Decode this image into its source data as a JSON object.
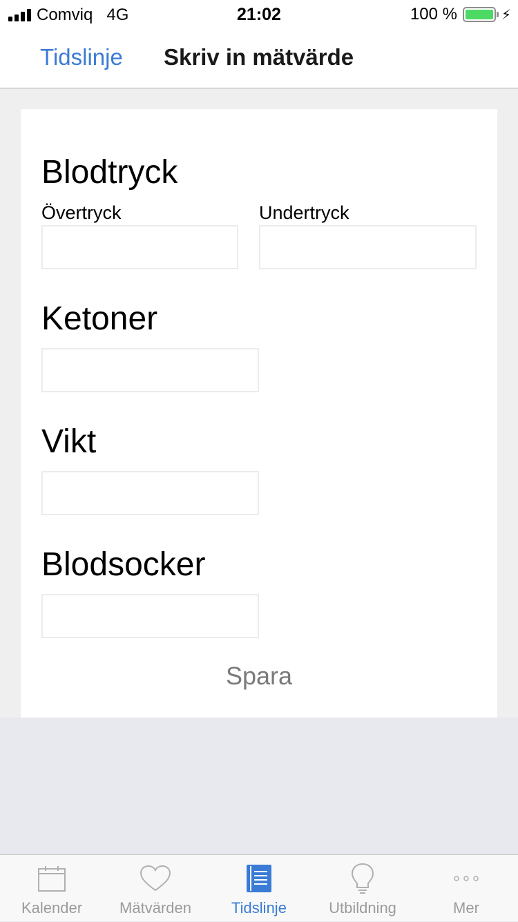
{
  "status_bar": {
    "carrier": "Comviq",
    "network": "4G",
    "time": "21:02",
    "battery_percent": "100 %"
  },
  "nav": {
    "back_label": "Tidslinje",
    "title": "Skriv in mätvärde"
  },
  "form": {
    "blood_pressure": {
      "title": "Blodtryck",
      "systolic_label": "Övertryck",
      "systolic_value": "",
      "diastolic_label": "Undertryck",
      "diastolic_value": ""
    },
    "ketones": {
      "title": "Ketoner",
      "value": ""
    },
    "weight": {
      "title": "Vikt",
      "value": ""
    },
    "blood_sugar": {
      "title": "Blodsocker",
      "value": ""
    },
    "save_label": "Spara"
  },
  "tabs": [
    {
      "label": "Kalender",
      "icon": "calendar-icon",
      "active": false
    },
    {
      "label": "Mätvärden",
      "icon": "heart-icon",
      "active": false
    },
    {
      "label": "Tidslinje",
      "icon": "timeline-icon",
      "active": true
    },
    {
      "label": "Utbildning",
      "icon": "lightbulb-icon",
      "active": false
    },
    {
      "label": "Mer",
      "icon": "more-icon",
      "active": false
    }
  ],
  "colors": {
    "accent": "#3a7bd5",
    "battery": "#4cd964",
    "inactive_tab": "#9b9b9b"
  }
}
